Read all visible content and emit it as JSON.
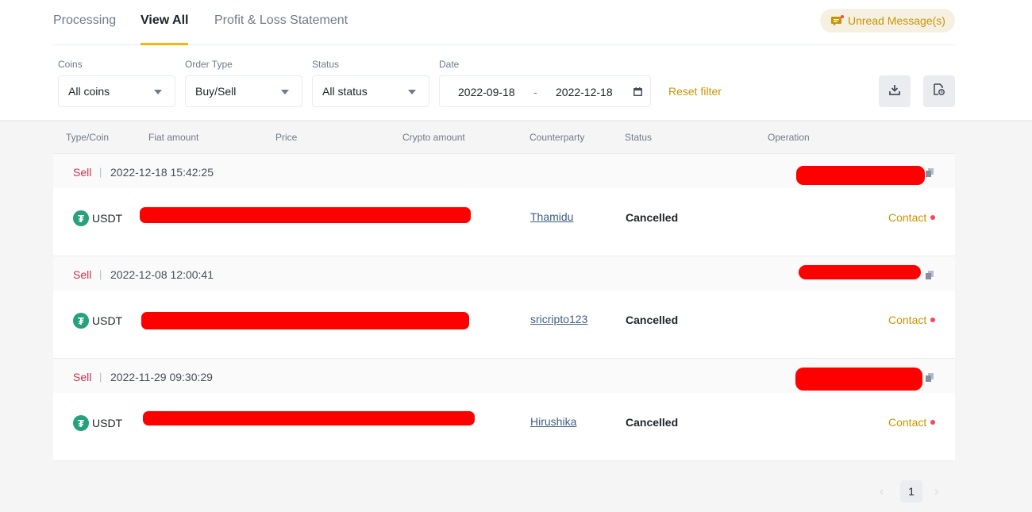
{
  "tabs": [
    {
      "label": "Processing"
    },
    {
      "label": "View All"
    },
    {
      "label": "Profit & Loss Statement"
    }
  ],
  "unread": {
    "label": "Unread Message(s)"
  },
  "filters": {
    "coins": {
      "label": "Coins",
      "value": "All coins"
    },
    "order_type": {
      "label": "Order Type",
      "value": "Buy/Sell"
    },
    "status": {
      "label": "Status",
      "value": "All status"
    },
    "date": {
      "label": "Date",
      "from": "2022-09-18",
      "separator": "-",
      "to": "2022-12-18"
    },
    "reset_label": "Reset filter"
  },
  "columns": [
    "Type/Coin",
    "Fiat amount",
    "Price",
    "Crypto amount",
    "Counterparty",
    "Status",
    "Operation"
  ],
  "orders": [
    {
      "type": "Sell",
      "time": "2022-12-18 15:42:25",
      "coin": "USDT",
      "counterparty": "Thamidu",
      "status": "Cancelled",
      "action": "Contact"
    },
    {
      "type": "Sell",
      "time": "2022-12-08 12:00:41",
      "coin": "USDT",
      "counterparty": "sricripto123",
      "status": "Cancelled",
      "action": "Contact"
    },
    {
      "type": "Sell",
      "time": "2022-11-29 09:30:29",
      "coin": "USDT",
      "counterparty": "Hirushika",
      "status": "Cancelled",
      "action": "Contact"
    }
  ],
  "pagination": {
    "current": "1",
    "prev": "‹",
    "next": "›"
  },
  "icons": {
    "coin_symbol": "₮"
  },
  "colors": {
    "accent": "#f0b90b",
    "sell": "#cf304a",
    "link": "#c99400",
    "redaction": "#ff0000",
    "tether": "#26a17b"
  }
}
